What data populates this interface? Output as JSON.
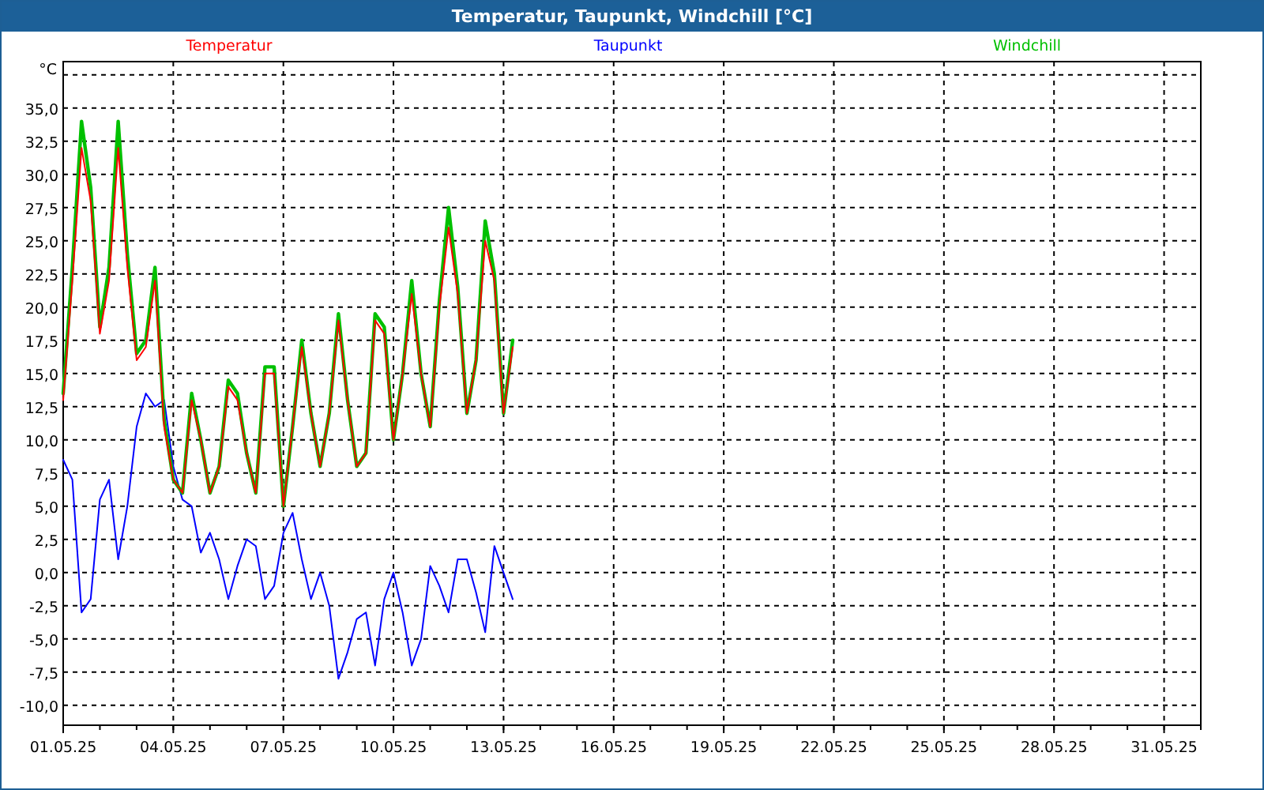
{
  "window": {
    "title": "Temperatur, Taupunkt, Windchill [°C]"
  },
  "chart": {
    "chart_data": {
      "type": "line",
      "ylabel": "°C",
      "grid": true,
      "categories": [
        "01.05.25",
        null,
        null,
        null,
        null,
        null,
        null,
        null,
        null,
        null,
        null,
        null,
        "04.05.25",
        null,
        null,
        null,
        null,
        null,
        null,
        null,
        null,
        null,
        null,
        null,
        "07.05.25",
        null,
        null,
        null,
        null,
        null,
        null,
        null,
        null,
        null,
        null,
        null,
        "10.05.25",
        null,
        null,
        null,
        null,
        null,
        null,
        null,
        null,
        null,
        null,
        null,
        "13.05.25",
        null,
        null,
        null,
        null,
        null,
        null,
        null,
        null,
        null,
        null,
        null,
        "16.05.25",
        null,
        null,
        null,
        null,
        null,
        null,
        null,
        null,
        null,
        null,
        null,
        "19.05.25",
        null,
        null,
        null,
        null,
        null,
        null,
        null,
        null,
        null,
        null,
        null,
        "22.05.25",
        null,
        null,
        null,
        null,
        null,
        null,
        null,
        null,
        null,
        null,
        null,
        "25.05.25",
        null,
        null,
        null,
        null,
        null,
        null,
        null,
        null,
        null,
        null,
        null,
        "28.05.25",
        null,
        null,
        null,
        null,
        null,
        null,
        null,
        null,
        null,
        null,
        null,
        "31.05.25",
        null,
        null,
        null
      ],
      "series": [
        {
          "name": "Temperatur",
          "color": "#ff0000",
          "values": [
            13,
            22,
            32,
            28,
            18,
            22,
            32,
            23,
            16,
            17,
            22,
            11,
            7,
            6,
            13,
            10,
            6,
            8,
            14,
            13,
            9,
            6,
            15,
            15,
            5,
            11,
            17,
            12,
            8,
            12,
            19,
            13,
            8,
            9,
            19,
            18,
            10,
            15,
            21,
            15,
            11,
            20,
            26,
            21,
            12,
            16,
            25,
            22,
            12,
            17,
            null,
            null,
            null,
            null,
            null,
            null,
            null,
            null,
            null,
            null,
            null,
            null,
            null,
            null,
            null,
            null,
            null,
            null,
            null,
            null,
            null,
            null,
            null,
            null,
            null,
            null,
            null,
            null,
            null,
            null,
            null,
            null,
            null,
            null,
            null,
            null,
            null,
            null,
            null,
            null,
            null,
            null,
            null,
            null,
            null,
            null,
            null,
            null,
            null,
            null,
            null,
            null,
            null,
            null,
            null,
            null,
            null,
            null,
            null,
            null,
            null,
            null,
            null,
            null,
            null,
            null,
            null,
            null,
            null,
            null,
            null,
            null,
            null,
            null
          ]
        },
        {
          "name": "Taupunkt",
          "color": "#0000ff",
          "values": [
            8.5,
            7,
            -3,
            -2,
            5.5,
            7,
            1,
            5,
            11,
            13.5,
            12.5,
            13,
            8,
            5.5,
            5,
            1.5,
            3,
            1,
            -2,
            0.5,
            2.5,
            2,
            -2,
            -1,
            3,
            4.5,
            1,
            -2,
            0,
            -2.5,
            -8,
            -6,
            -3.5,
            -3,
            -7,
            -2,
            0,
            -3,
            -7,
            -5,
            0.5,
            -1,
            -3,
            1,
            1,
            -1.5,
            -4.5,
            2,
            0,
            -2,
            null,
            null,
            null,
            null,
            null,
            null,
            null,
            null,
            null,
            null,
            null,
            null,
            null,
            null,
            null,
            null,
            null,
            null,
            null,
            null,
            null,
            null,
            null,
            null,
            null,
            null,
            null,
            null,
            null,
            null,
            null,
            null,
            null,
            null,
            null,
            null,
            null,
            null,
            null,
            null,
            null,
            null,
            null,
            null,
            null,
            null,
            null,
            null,
            null,
            null,
            null,
            null,
            null,
            null,
            null,
            null,
            null,
            null,
            null,
            null,
            null,
            null,
            null,
            null,
            null,
            null,
            null,
            null,
            null,
            null,
            null,
            null,
            null,
            null
          ]
        },
        {
          "name": "Windchill",
          "color": "#00c000",
          "values": [
            13.5,
            23,
            34,
            29,
            18.5,
            23,
            34,
            24,
            16.5,
            17.5,
            23,
            11.5,
            7,
            6,
            13.5,
            10,
            6,
            8,
            14.5,
            13.5,
            9,
            6,
            15.5,
            15.5,
            5,
            11,
            17.5,
            12,
            8,
            12,
            19.5,
            13,
            8,
            9,
            19.5,
            18.5,
            10,
            15,
            22,
            15,
            11,
            20.5,
            27.5,
            21.5,
            12,
            16,
            26.5,
            22.5,
            12,
            17.5,
            null,
            null,
            null,
            null,
            null,
            null,
            null,
            null,
            null,
            null,
            null,
            null,
            null,
            null,
            null,
            null,
            null,
            null,
            null,
            null,
            null,
            null,
            null,
            null,
            null,
            null,
            null,
            null,
            null,
            null,
            null,
            null,
            null,
            null,
            null,
            null,
            null,
            null,
            null,
            null,
            null,
            null,
            null,
            null,
            null,
            null,
            null,
            null,
            null,
            null,
            null,
            null,
            null,
            null,
            null,
            null,
            null,
            null,
            null,
            null,
            null,
            null,
            null,
            null,
            null,
            null,
            null,
            null,
            null,
            null,
            null,
            null,
            null,
            null
          ]
        }
      ],
      "ylim": [
        -11.5,
        38.5
      ],
      "yticks": [
        {
          "value": -10,
          "label": "-10,0"
        },
        {
          "value": -7.5,
          "label": "-7,5"
        },
        {
          "value": -5,
          "label": "-5,0"
        },
        {
          "value": -2.5,
          "label": "-2,5"
        },
        {
          "value": 0,
          "label": "0,0"
        },
        {
          "value": 2.5,
          "label": "2,5"
        },
        {
          "value": 5,
          "label": "5,0"
        },
        {
          "value": 7.5,
          "label": "7,5"
        },
        {
          "value": 10,
          "label": "10,0"
        },
        {
          "value": 12.5,
          "label": "12,5"
        },
        {
          "value": 15,
          "label": "15,0"
        },
        {
          "value": 17.5,
          "label": "17,5"
        },
        {
          "value": 20,
          "label": "20,0"
        },
        {
          "value": 22.5,
          "label": "22,5"
        },
        {
          "value": 25,
          "label": "25,0"
        },
        {
          "value": 27.5,
          "label": "27,5"
        },
        {
          "value": 30,
          "label": "30,0"
        },
        {
          "value": 32.5,
          "label": "32,5"
        },
        {
          "value": 35,
          "label": "35,0"
        }
      ]
    }
  }
}
